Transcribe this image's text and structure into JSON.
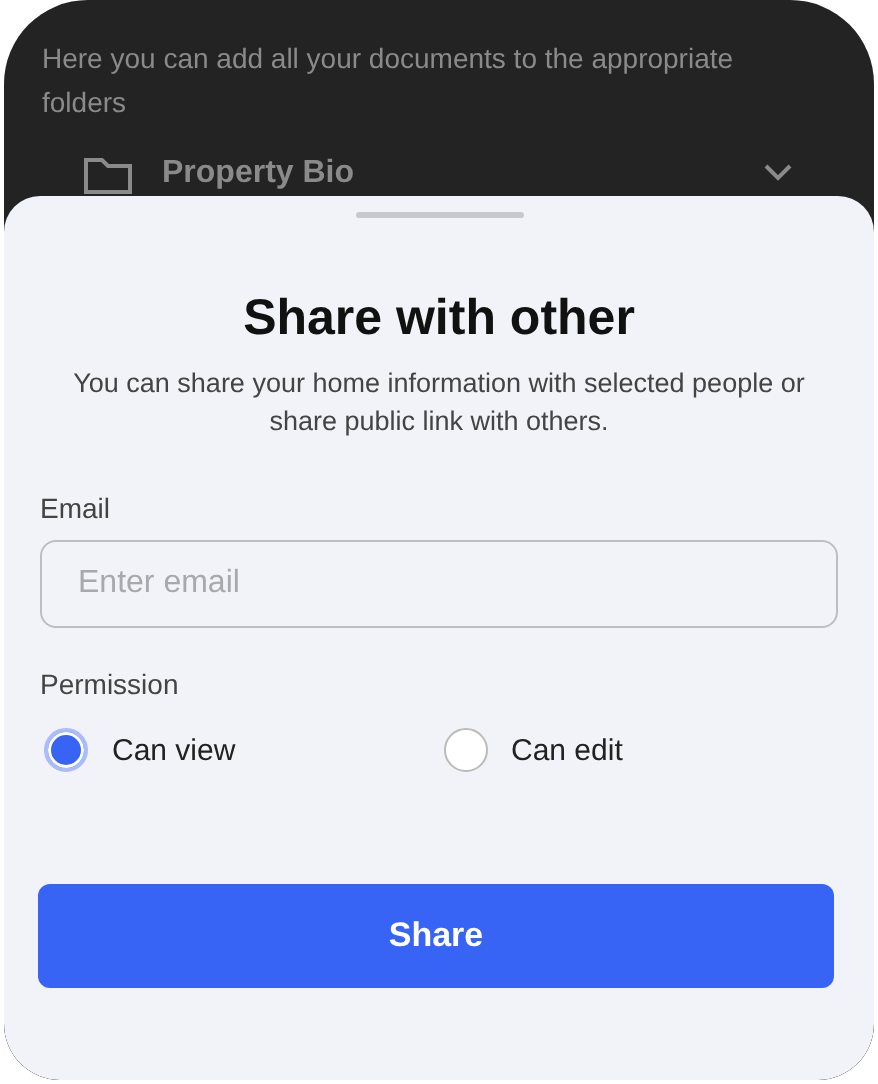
{
  "background": {
    "description": "Here you can add all your documents to the appropriate folders",
    "folder": {
      "name": "Property Bio"
    }
  },
  "sheet": {
    "title": "Share with other",
    "subtitle": "You can share your home information with selected people or share public link with others.",
    "email": {
      "label": "Email",
      "placeholder": "Enter email"
    },
    "permission": {
      "label": "Permission",
      "options": [
        {
          "label": "Can view",
          "selected": true
        },
        {
          "label": "Can edit",
          "selected": false
        }
      ]
    },
    "button": "Share"
  }
}
